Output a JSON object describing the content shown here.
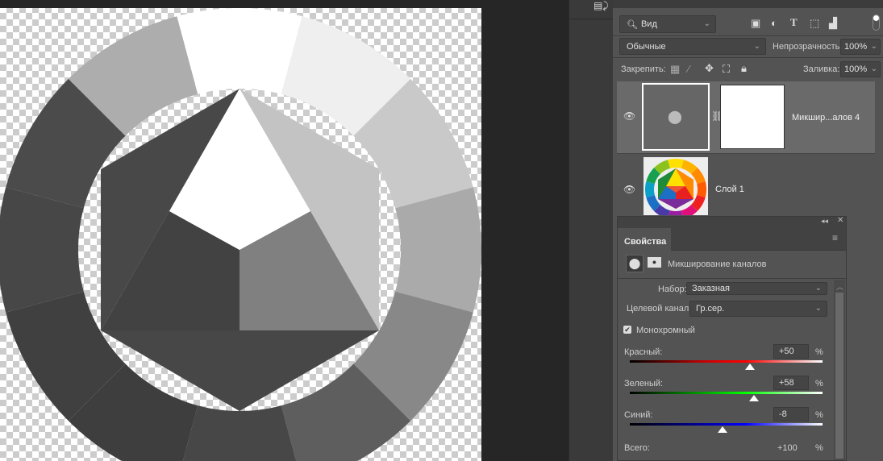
{
  "layers_panel": {
    "filter_kind": "Вид",
    "blend_mode": "Обычные",
    "opacity_label": "Непрозрачность:",
    "opacity_value": "100%",
    "lock_label": "Закрепить:",
    "fill_label": "Заливка:",
    "fill_value": "100%",
    "layers": [
      {
        "name": "Микшир...алов 4",
        "visible": true,
        "selected": true
      },
      {
        "name": "Слой 1",
        "visible": true,
        "selected": false
      }
    ]
  },
  "properties": {
    "tab": "Свойства",
    "adjustment_title": "Микширование каналов",
    "preset_label": "Набор:",
    "preset_value": "Заказная",
    "target_label": "Целевой канал:",
    "target_value": "Гр.сер.",
    "monochrome_label": "Монохромный",
    "monochrome_checked": true,
    "channels": [
      {
        "label": "Красный:",
        "value": "+50",
        "num": 50,
        "unit": "%"
      },
      {
        "label": "Зеленый:",
        "value": "+58",
        "num": 58,
        "unit": "%"
      },
      {
        "label": "Синий:",
        "value": "-8",
        "num": -8,
        "unit": "%"
      }
    ],
    "slider_range": [
      -200,
      200
    ],
    "total_label": "Всего:",
    "total_value": "+100",
    "total_unit": "%"
  },
  "canvas": {
    "ring_grays": [
      "#ffffff",
      "#efefef",
      "#c9c9c9",
      "#aaaaaa",
      "#888888",
      "#5e5e5e",
      "#474747",
      "#3e3e3e",
      "#404040",
      "#474747",
      "#4b4b4b",
      "#adadad"
    ]
  }
}
